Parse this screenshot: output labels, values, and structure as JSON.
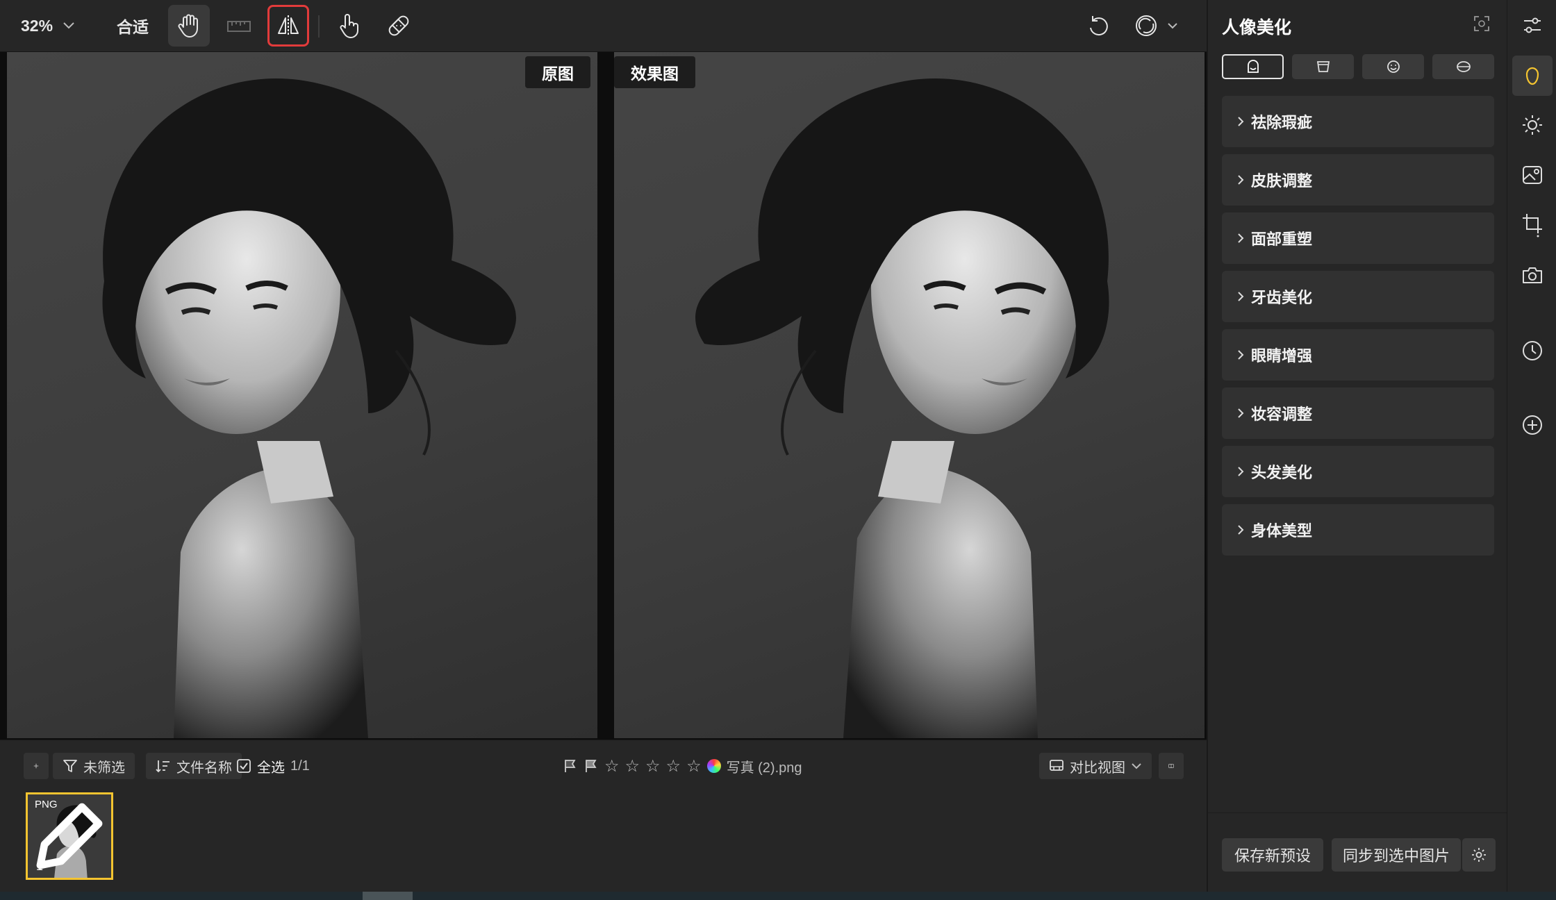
{
  "toolbar": {
    "zoom": "32%",
    "fit_label": "合适"
  },
  "canvas": {
    "original_label": "原图",
    "effect_label": "效果图"
  },
  "filterbar": {
    "filter_label": "未筛选",
    "sort_label": "文件名称",
    "select_all_label": "全选",
    "count": "1/1",
    "filename": "写真 (2).png",
    "view_label": "对比视图"
  },
  "thumbnail": {
    "format": "PNG",
    "index": "1"
  },
  "panel": {
    "title": "人像美化",
    "sections": [
      {
        "label": "祛除瑕疵"
      },
      {
        "label": "皮肤调整"
      },
      {
        "label": "面部重塑"
      },
      {
        "label": "牙齿美化"
      },
      {
        "label": "眼睛增强"
      },
      {
        "label": "妆容调整"
      },
      {
        "label": "头发美化"
      },
      {
        "label": "身体美型"
      }
    ],
    "save_preset_label": "保存新预设",
    "sync_label": "同步到选中图片"
  },
  "colors": {
    "accent_yellow": "#f4c430",
    "selected_tool_border": "#e23b3b"
  }
}
